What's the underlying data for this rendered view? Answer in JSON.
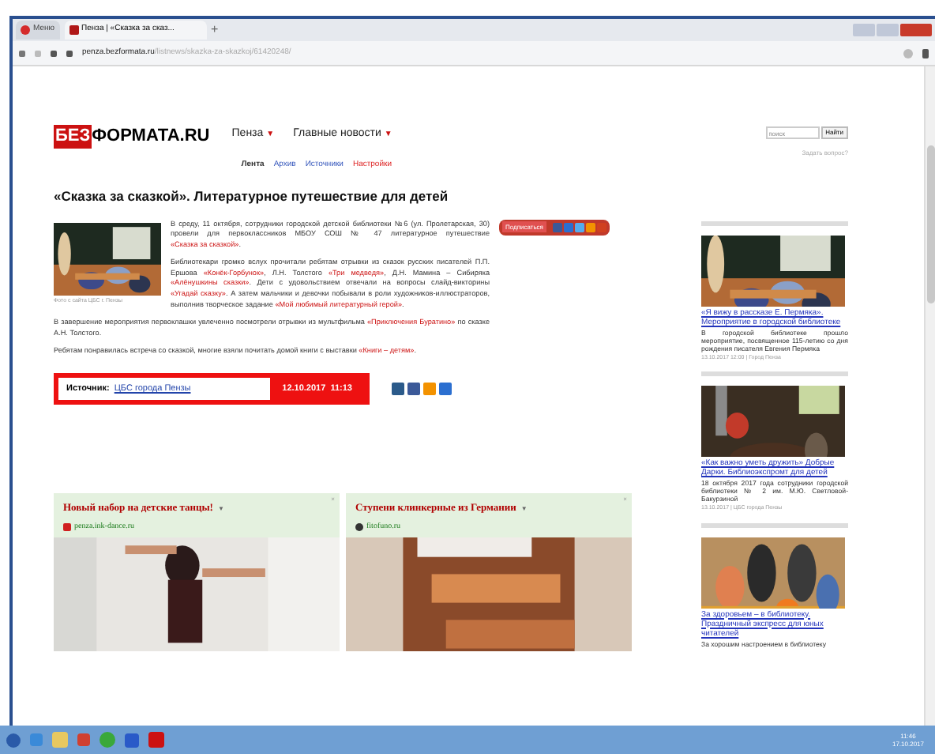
{
  "browser": {
    "tabs": [
      {
        "label": "Меню",
        "selected": false
      },
      {
        "label": "Пенза | «Сказка за сказ...",
        "selected": true
      }
    ],
    "new_tab": "+",
    "url_host": "penza.bezformata.ru",
    "url_path": "/listnews/skazka-za-skazkoj/61420248/"
  },
  "header": {
    "logo_mark": "БЕЗ",
    "logo_text": "ФОРМАТА.RU",
    "nav": [
      {
        "label": "Пенза",
        "caret": "▼"
      },
      {
        "label": "Главные новости",
        "caret": "▼"
      }
    ],
    "subnav": [
      {
        "label": "Лента",
        "kind": "current"
      },
      {
        "label": "Архив",
        "kind": "link"
      },
      {
        "label": "Источники",
        "kind": "link"
      },
      {
        "label": "Настройки",
        "kind": "accent"
      }
    ],
    "search": {
      "placeholder": "поиск",
      "button": "Найти",
      "help_link": "Задать вопрос?"
    }
  },
  "article": {
    "title": "«Сказка за сказкой». Литературное путешествие для детей",
    "photo_caption": "Фото с сайта ЦБС г. Пензы",
    "paragraphs": [
      [
        {
          "kind": "text",
          "text": "В среду, 11 октября, сотрудники городской детской библиотеки №6 (ул. Пролетарская, 30) провели для первоклассников МБОУ СОШ № 47 литературное путешествие "
        },
        {
          "kind": "link",
          "text": "«Сказка за сказкой»"
        },
        {
          "kind": "text",
          "text": "."
        }
      ],
      [
        {
          "kind": "text",
          "text": "Библиотекари громко вслух прочитали ребятам отрывки из сказок русских писателей П.П. Ершова "
        },
        {
          "kind": "link",
          "text": "«Конёк-Горбунок»"
        },
        {
          "kind": "text",
          "text": ", Л.Н. Толстого "
        },
        {
          "kind": "link",
          "text": "«Три медведя»"
        },
        {
          "kind": "text",
          "text": ", Д.Н. Мамина – Сибиряка "
        },
        {
          "kind": "link",
          "text": "«Алёнушкины сказки»"
        },
        {
          "kind": "text",
          "text": ". Дети с удовольствием отвечали на вопросы слайд-викторины "
        },
        {
          "kind": "link",
          "text": "«Угадай сказку»"
        },
        {
          "kind": "text",
          "text": ". А затем мальчики и девочки побывали в роли художников-иллюстраторов, выполнив творческое задание "
        },
        {
          "kind": "link",
          "text": "«Мой любимый литературный герой»"
        },
        {
          "kind": "text",
          "text": "."
        }
      ],
      [
        {
          "kind": "text",
          "text": "В завершение мероприятия первоклашки увлеченно посмотрели отрывки из мультфильма "
        },
        {
          "kind": "link",
          "text": "«Приключения Буратино»"
        },
        {
          "kind": "text",
          "text": " по сказке А.Н. Толстого."
        }
      ],
      [
        {
          "kind": "text",
          "text": "Ребятам понравилась встреча со сказкой, многие взяли почитать домой книги с выставки "
        },
        {
          "kind": "link",
          "text": "«Книги – детям»"
        },
        {
          "kind": "text",
          "text": "."
        }
      ]
    ],
    "subscribe": "Подписаться",
    "source": {
      "label": "Источник:",
      "name": "ЦБС города Пензы",
      "date": "12.10.2017  11:13"
    }
  },
  "sidebar_news": [
    {
      "title": "«Я вижу в рассказе Е. Пермяка». Мероприятие в городской библиотеке",
      "text": "В городской библиотеке прошло мероприятие, посвященное 115-летию со дня рождения писателя Евгения Пермяка",
      "meta": "13.10.2017 12:00 | Город Пенза"
    },
    {
      "title": "«Как важно уметь дружить» Добрые Дарки. Библиоэкспромт для детей",
      "text": "18 октября 2017 года сотрудники городской библиотеки № 2 им. М.Ю. Светловой-Бакурзиной",
      "meta": "13.10.2017 | ЦБС города Пензы"
    },
    {
      "title": "За здоровьем – в библиотеку. Праздничный экспресс для юных читателей",
      "text": "За хорошим настроением в библиотеку"
    }
  ],
  "ads": [
    {
      "title": "Новый набор на детские танцы!",
      "caret": "▼",
      "close": "×",
      "domain": "penza.ink-dance.ru"
    },
    {
      "title": "Ступени клинкерные из Германии",
      "caret": "▼",
      "close": "×",
      "domain": "fitofuno.ru"
    }
  ],
  "taskbar": {
    "time": "11:46",
    "date": "17.10.2017"
  }
}
